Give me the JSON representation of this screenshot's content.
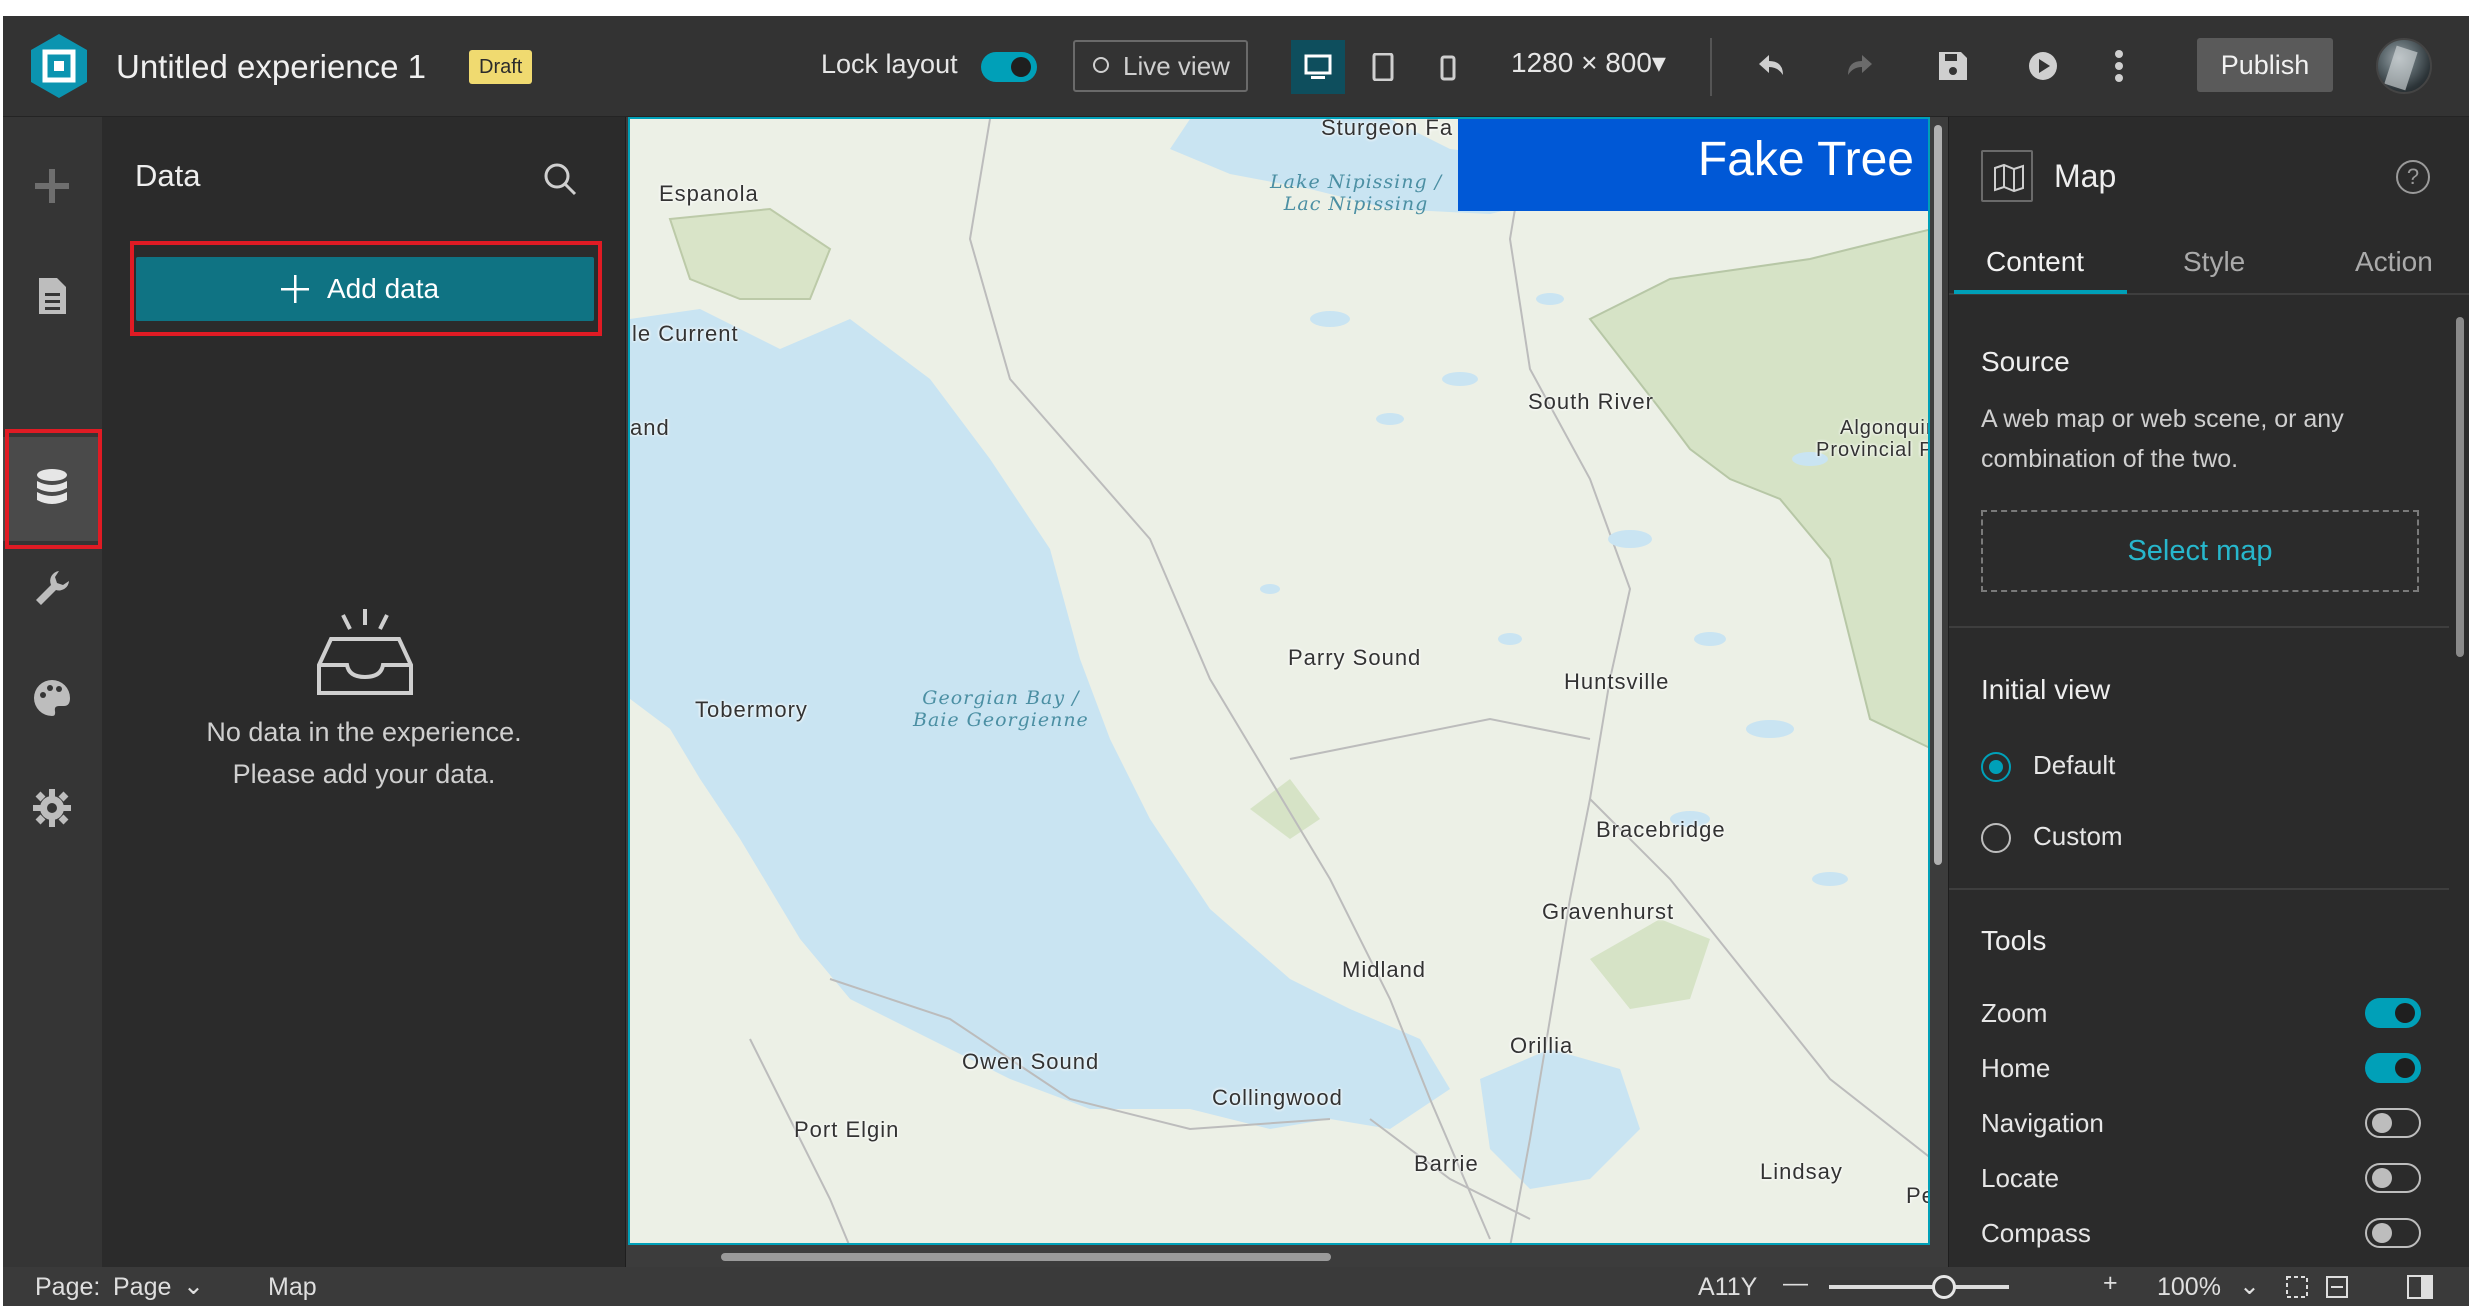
{
  "header": {
    "title": "Untitled experience 1",
    "badge": "Draft",
    "lock_layout_label": "Lock layout",
    "lock_layout_on": true,
    "live_view_label": "Live view",
    "resolution": "1280 × 800▾",
    "publish_label": "Publish"
  },
  "data_panel": {
    "title": "Data",
    "add_button_label": "Add data",
    "empty_line1": "No data in the experience.",
    "empty_line2": "Please add your data."
  },
  "map": {
    "banner": "Fake Tree",
    "labels": {
      "sturgeon": "Sturgeon Fa",
      "espanola": "Espanola",
      "current": "le Current",
      "and": "and",
      "south_river": "South River",
      "algonquin1": "Algonquin",
      "algonquin2": "Provincial Pa",
      "parry_sound": "Parry Sound",
      "huntsville": "Huntsville",
      "tobermory": "Tobermory",
      "bracebridge": "Bracebridge",
      "gravenhurst": "Gravenhurst",
      "midland": "Midland",
      "orillia": "Orillia",
      "owen_sound": "Owen Sound",
      "collingwood": "Collingwood",
      "port_elgin": "Port Elgin",
      "barrie": "Barrie",
      "lindsay": "Lindsay",
      "pe": "Pe"
    },
    "water_labels": {
      "nipissing1": "Lake Nipissing /",
      "nipissing2": "Lac Nipissing",
      "georgian1": "Georgian Bay /",
      "georgian2": "Baie Georgienne"
    }
  },
  "settings": {
    "title": "Map",
    "tabs": [
      "Content",
      "Style",
      "Action"
    ],
    "source_title": "Source",
    "source_desc": "A web map or web scene, or any combination of the two.",
    "select_map_label": "Select map",
    "initial_view_title": "Initial view",
    "view_options": [
      "Default",
      "Custom"
    ],
    "tools_title": "Tools",
    "tools": [
      {
        "label": "Zoom",
        "on": true
      },
      {
        "label": "Home",
        "on": true
      },
      {
        "label": "Navigation",
        "on": false
      },
      {
        "label": "Locate",
        "on": false
      },
      {
        "label": "Compass",
        "on": false
      }
    ]
  },
  "footer": {
    "page_label": "Page:",
    "page_value": "Page",
    "map_label": "Map",
    "a11y": "A11Y",
    "zoom_minus": "—",
    "zoom_plus": "+",
    "zoom_value": "100%",
    "zoom_level": 0.64
  },
  "colors": {
    "accent": "#00a0b8",
    "primary_button": "#0f7383",
    "banner_blue": "#0058d6",
    "highlight_red": "#e01b24",
    "draft_yellow": "#f0da70"
  }
}
